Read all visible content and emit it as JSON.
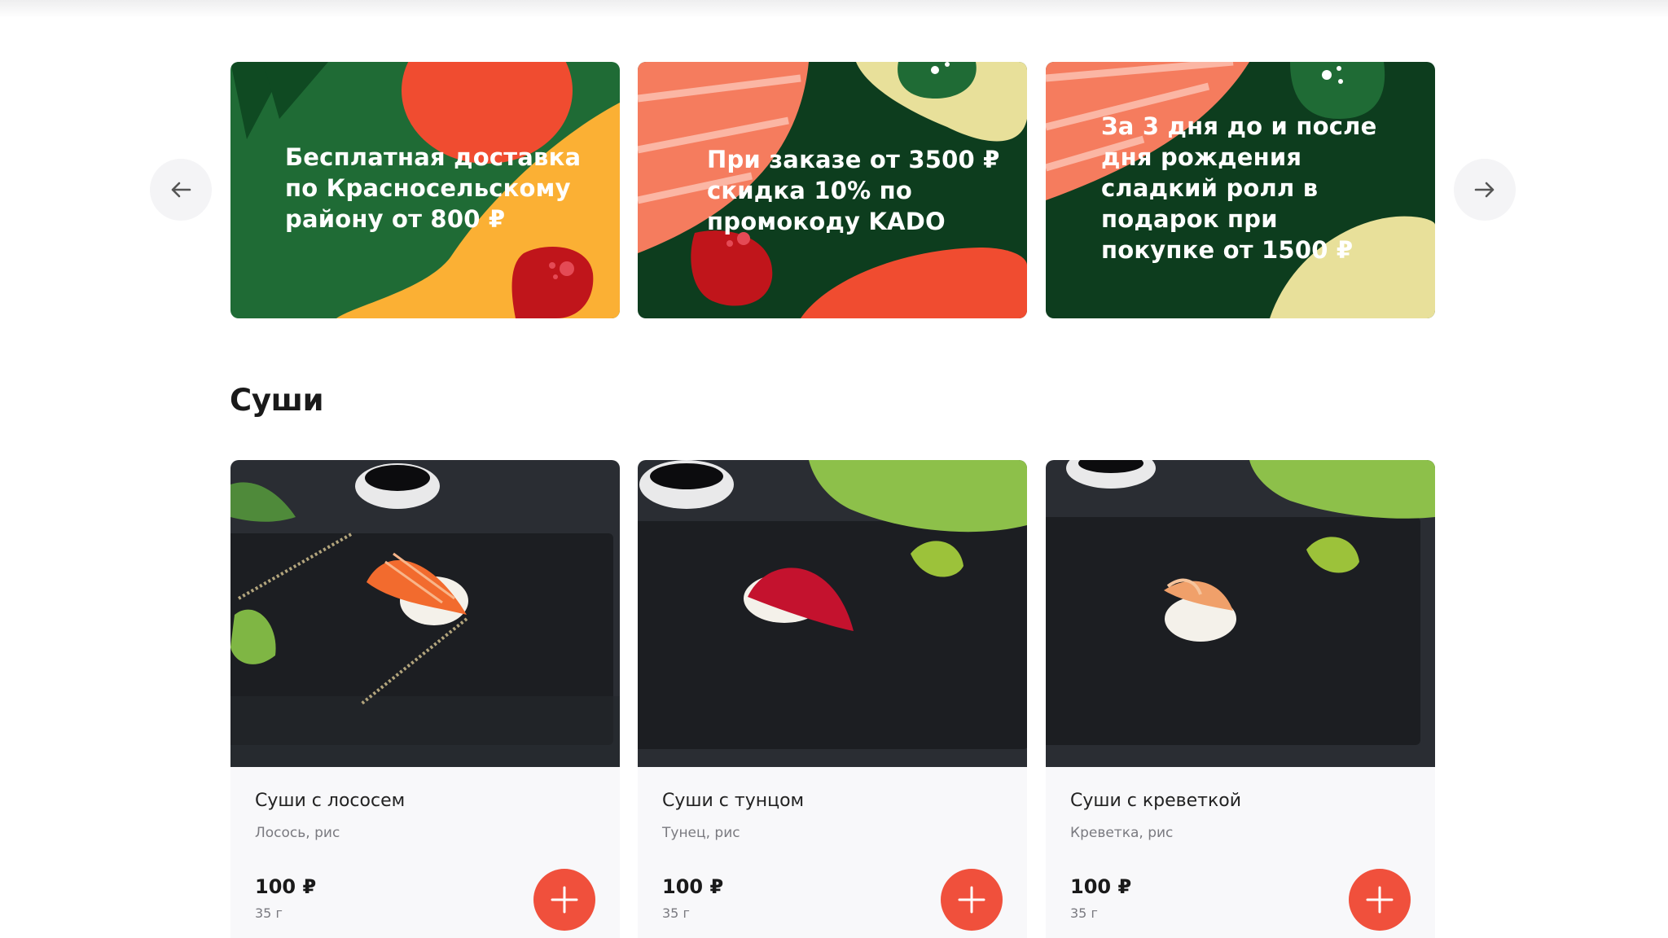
{
  "slider": {
    "prev_icon": "arrow-left-icon",
    "next_icon": "arrow-right-icon",
    "banners": [
      {
        "text": "Бесплатная доставка\nпо Красносельскому\nрайону от 800 ₽"
      },
      {
        "text": "При заказе от 3500 ₽\nскидка 10% по\nпромокоду KADO"
      },
      {
        "text": "За 3 дня до и после\nдня рождения\nсладкий ролл в\nподарок при\nпокупке от 1500 ₽"
      }
    ]
  },
  "section": {
    "title": "Суши"
  },
  "products": [
    {
      "name": "Суши с лососем",
      "description": "Лосось, рис",
      "price": "100 ₽",
      "weight": "35 г"
    },
    {
      "name": "Суши с тунцом",
      "description": "Тунец, рис",
      "price": "100 ₽",
      "weight": "35 г"
    },
    {
      "name": "Суши с креветкой",
      "description": "Креветка, рис",
      "price": "100 ₽",
      "weight": "35 г"
    }
  ],
  "colors": {
    "accent": "#f0503c",
    "banner_green": "#1f6b35",
    "banner_dark_green": "#0d3d1e",
    "salmon": "#f57c5e",
    "yellow": "#fbb034",
    "cream": "#e8e09a"
  }
}
